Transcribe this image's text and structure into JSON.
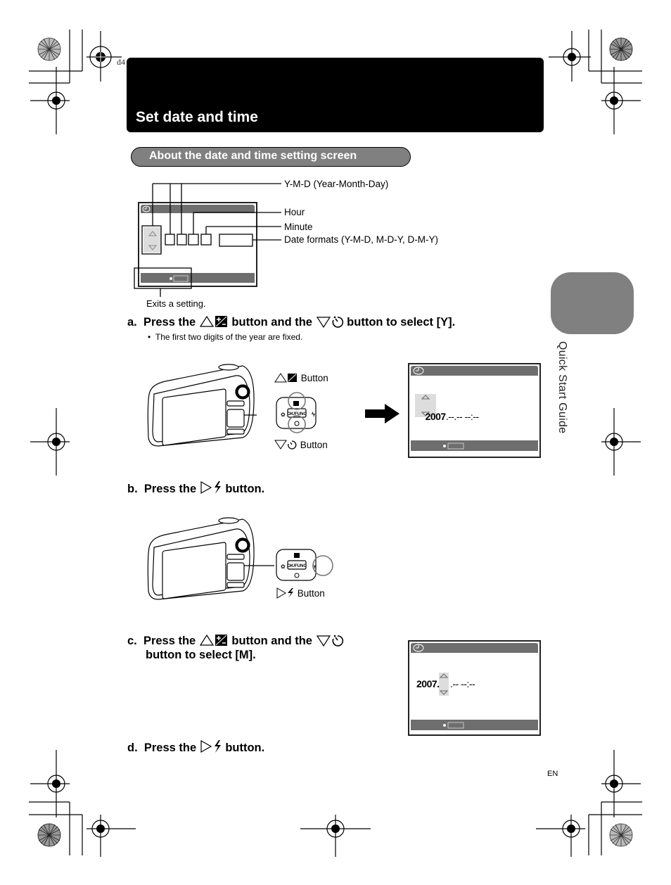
{
  "page": {
    "slug": "d4",
    "title": "Set date and time",
    "section_heading": "About the date and time setting screen",
    "side_tab_label": "Quick Start Guide",
    "language_code": "EN"
  },
  "diagram": {
    "callouts": {
      "ymd": "Y-M-D (Year-Month-Day)",
      "hour": "Hour",
      "minute": "Minute",
      "date_formats": "Date formats (Y-M-D, M-D-Y, D-M-Y)",
      "exit": "Exits a setting."
    }
  },
  "steps": [
    {
      "letter": "a.",
      "pre": "Press the",
      "icon1": "up-exposure-icon",
      "mid": "button and the",
      "icon2": "down-selftimer-icon",
      "post": "button to select [Y].",
      "note": "The first two digits of the year are fixed."
    },
    {
      "letter": "b.",
      "pre": "Press the",
      "icon1": "right-flash-icon",
      "post": "button."
    },
    {
      "letter": "c.",
      "pre": "Press the",
      "icon1": "up-exposure-icon",
      "mid": "button and the",
      "icon2": "down-selftimer-icon",
      "post_line2": "button to select [M]."
    },
    {
      "letter": "d.",
      "pre": "Press the",
      "icon1": "right-flash-icon",
      "post": "button."
    }
  ],
  "camera_figures": {
    "up_button_label": "Button",
    "down_button_label": "Button",
    "right_button_label": "Button",
    "ok_label": "OK/FUNC"
  },
  "screens": {
    "screen_a": {
      "year": "2007",
      "rest": ".--.-- --:--"
    },
    "screen_c": {
      "year": "2007.",
      "rest": ".-- --:--"
    }
  }
}
